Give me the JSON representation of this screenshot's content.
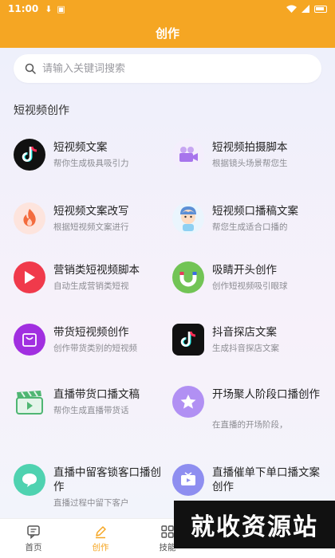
{
  "status_bar": {
    "time": "11:00"
  },
  "header": {
    "title": "创作"
  },
  "search": {
    "placeholder": "请输入关键词搜索"
  },
  "section": {
    "title": "短视频创作"
  },
  "items": [
    {
      "title": "短视频文案",
      "desc": "帮你生成极具吸引力",
      "icon": "tiktok-icon"
    },
    {
      "title": "短视频拍摄脚本",
      "desc": "根据镜头场景帮您生",
      "icon": "video-camera-icon"
    },
    {
      "title": "短视频文案改写",
      "desc": "根据短视频文案进行",
      "icon": "flame-icon"
    },
    {
      "title": "短视频口播稿文案",
      "desc": "帮您生成适合口播的",
      "icon": "character-icon"
    },
    {
      "title": "营销类短视频脚本",
      "desc": "自动生成营销类短视",
      "icon": "play-icon"
    },
    {
      "title": "吸睛开头创作",
      "desc": "创作短视频吸引眼球",
      "icon": "magnet-icon"
    },
    {
      "title": "带货短视频创作",
      "desc": "创作带货类别的短视频",
      "icon": "shopping-bag-icon"
    },
    {
      "title": "抖音探店文案",
      "desc": "生成抖音探店文案",
      "icon": "tiktok-square-icon"
    },
    {
      "title": "直播带货口播文稿",
      "desc": "帮你生成直播带货话",
      "icon": "clapperboard-icon"
    },
    {
      "title": "开场聚人阶段口播创作",
      "desc": "在直播的开场阶段，",
      "icon": "star-icon"
    },
    {
      "title": "直播中留客锁客口播创作",
      "desc": "直播过程中留下客户",
      "icon": "chat-bubble-icon"
    },
    {
      "title": "直播催单下单口播文案创作",
      "desc": "",
      "icon": "tv-icon"
    }
  ],
  "tabs": [
    {
      "label": "首页",
      "icon": "message-icon"
    },
    {
      "label": "创作",
      "icon": "pen-icon"
    },
    {
      "label": "技能",
      "icon": "grid-icon"
    }
  ],
  "watermark": {
    "text": "就收资源站"
  },
  "colors": {
    "accent": "#f5a623"
  }
}
